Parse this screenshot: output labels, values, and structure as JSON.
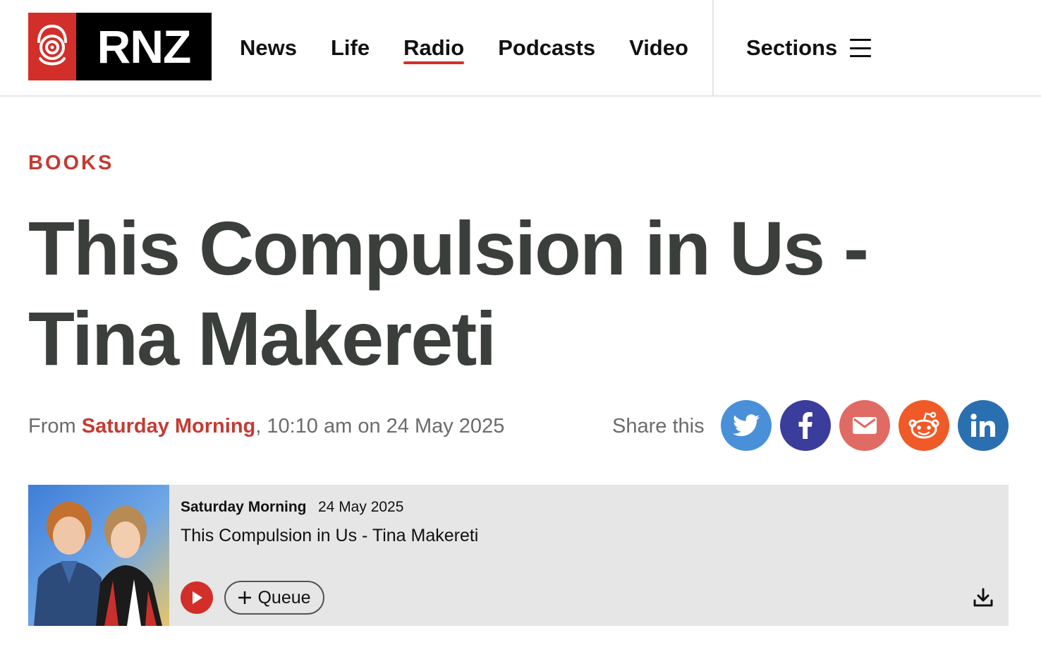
{
  "brand": {
    "logo_text": "RNZ",
    "red": "#d22f2a"
  },
  "nav": {
    "items": [
      {
        "label": "News",
        "active": false
      },
      {
        "label": "Life",
        "active": false
      },
      {
        "label": "Radio",
        "active": true
      },
      {
        "label": "Podcasts",
        "active": false
      },
      {
        "label": "Video",
        "active": false
      }
    ],
    "sections_label": "Sections"
  },
  "article": {
    "category": "BOOKS",
    "headline": "This Compulsion in Us - Tina Makereti",
    "meta": {
      "from_label": "From",
      "programme": "Saturday Morning",
      "datetime": ", 10:10 am on 24 May 2025"
    }
  },
  "share": {
    "label": "Share this",
    "buttons": [
      {
        "name": "twitter",
        "icon": "twitter-icon",
        "color": "#4a90d9"
      },
      {
        "name": "facebook",
        "icon": "facebook-icon",
        "color": "#3b3d9c"
      },
      {
        "name": "email",
        "icon": "email-icon",
        "color": "#e06b64"
      },
      {
        "name": "reddit",
        "icon": "reddit-icon",
        "color": "#ef5a28"
      },
      {
        "name": "linkedin",
        "icon": "linkedin-icon",
        "color": "#2a6fb0"
      }
    ]
  },
  "player": {
    "programme": "Saturday Morning",
    "date": "24 May 2025",
    "title": "This Compulsion in Us - Tina Makereti",
    "queue_label": "Queue"
  }
}
